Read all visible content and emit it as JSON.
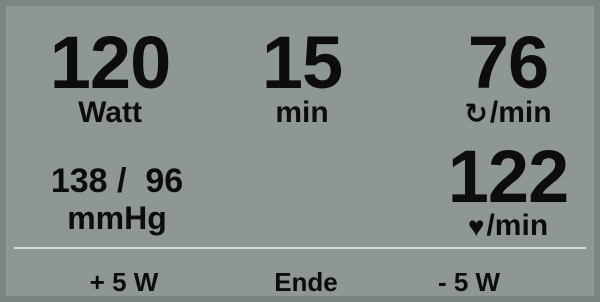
{
  "display": {
    "power": {
      "value": "120",
      "unit": "Watt"
    },
    "time": {
      "value": "15",
      "unit": "min"
    },
    "rpm": {
      "value": "76",
      "symbol": "↻",
      "unit": "/min",
      "symbol_name": "rotation-icon"
    },
    "blood_pressure": {
      "value": "138 /  96",
      "unit": "mmHg"
    },
    "heart_rate": {
      "value": "122",
      "symbol": "♥",
      "unit": "/min",
      "symbol_name": "heart-icon"
    }
  },
  "controls": {
    "increase_label": "+ 5 W",
    "end_label": "Ende",
    "decrease_label": "- 5 W"
  },
  "colors": {
    "background": "#8f9796",
    "border": "#7b8383",
    "text": "#0d0d0d",
    "divider": "#d6d9d9"
  }
}
